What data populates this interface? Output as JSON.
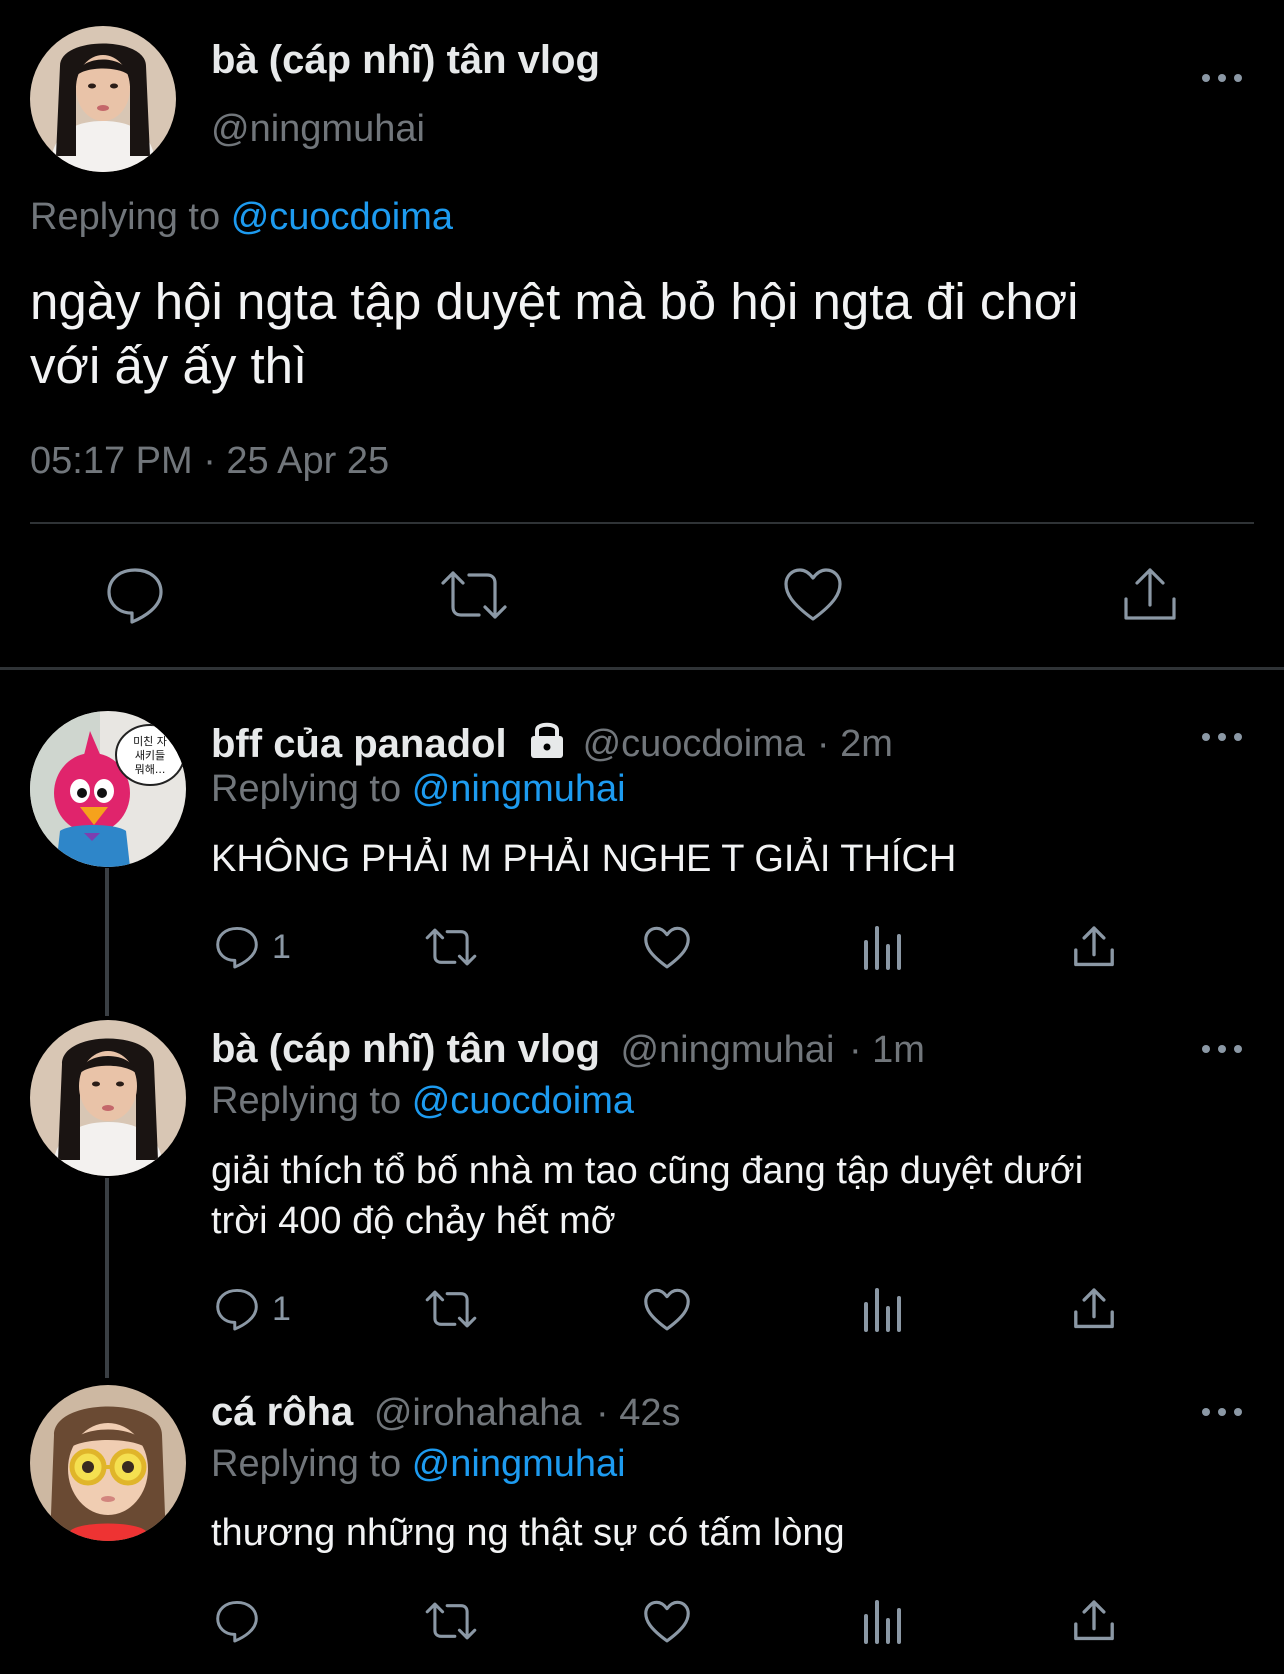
{
  "main_tweet": {
    "display_name": "bà (cáp nhĩ) tân vlog",
    "handle": "@ningmuhai",
    "replying_label": "Replying to",
    "replying_handle": "@cuocdoima",
    "text_line1": "ngày hội ngta tập duyệt mà bỏ hội ngta đi chơi",
    "text_line2": "với ấy ấy thì",
    "timestamp": "05:17 PM · 25 Apr 25"
  },
  "replies": [
    {
      "display_name": "bff của panadol",
      "handle": "@cuocdoima",
      "time": "· 2m",
      "replying_label": "Replying to",
      "replying_handle": "@ningmuhai",
      "text_line1": "KHÔNG PHẢI M PHẢI NGHE T GIẢI THÍCH",
      "text_line2": "",
      "reply_count": "1",
      "avatar_bubble": "미친 자\n새키들\n뭐해..."
    },
    {
      "display_name": "bà (cáp nhĩ) tân vlog",
      "handle": "@ningmuhai",
      "time": "· 1m",
      "replying_label": "Replying to",
      "replying_handle": "@cuocdoima",
      "text_line1": "giải thích tổ bố nhà m tao cũng đang tập duyệt dưới",
      "text_line2": "trời 400 độ chảy hết mỡ",
      "reply_count": "1"
    },
    {
      "display_name": "cá rôha",
      "handle": "@irohahaha",
      "time": "· 42s",
      "replying_label": "Replying to",
      "replying_handle": "@ningmuhai",
      "text_line1": "thương những ng thật sự có tấm lòng",
      "text_line2": "",
      "reply_count": ""
    }
  ],
  "colors": {
    "background": "#000000",
    "link": "#1d9bf0",
    "secondary": "#71767b"
  },
  "icons": [
    "reply-icon",
    "retweet-icon",
    "like-icon",
    "analytics-icon",
    "share-icon",
    "more-icon",
    "lock-icon"
  ]
}
